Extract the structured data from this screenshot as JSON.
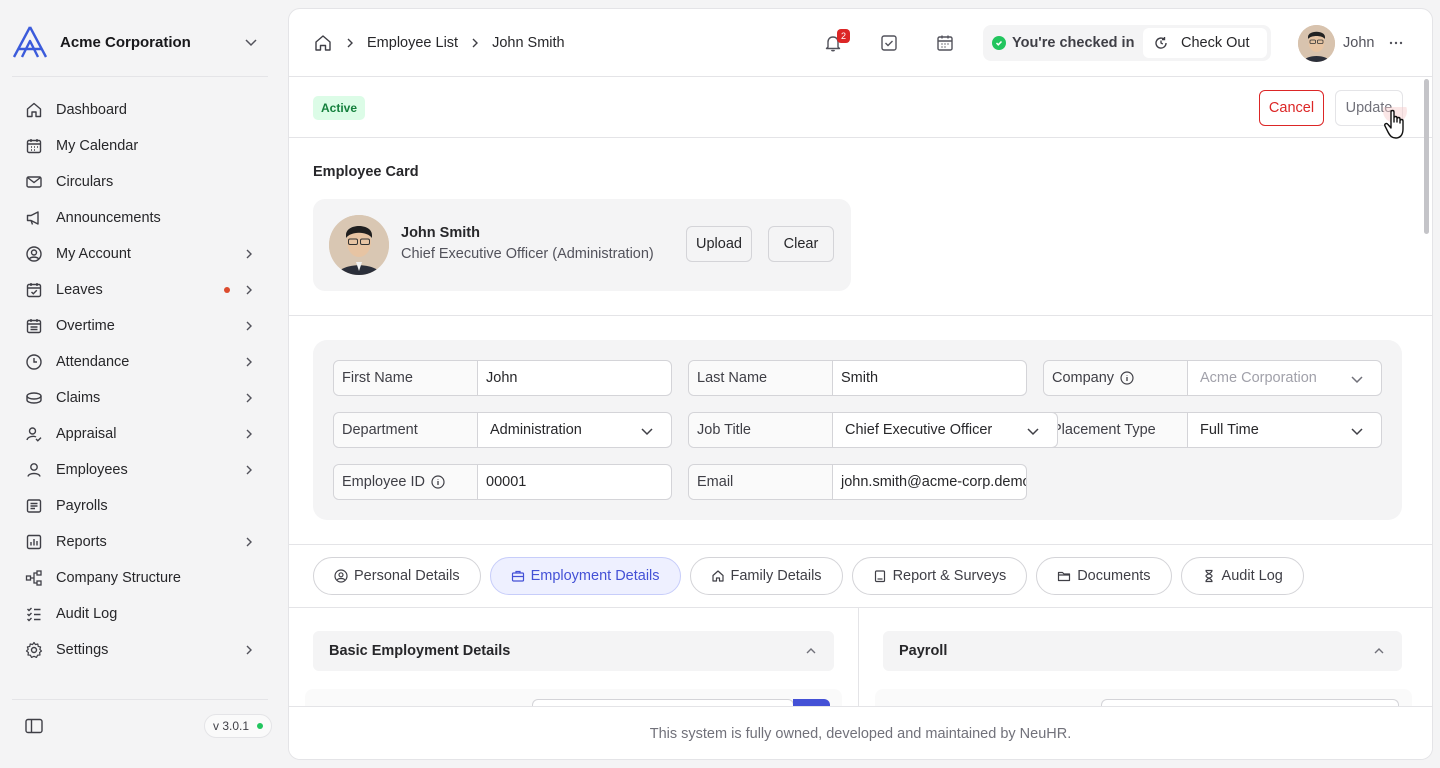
{
  "sidebar": {
    "company": "Acme Corporation",
    "items": [
      {
        "label": "Dashboard",
        "icon": "home-icon",
        "arrow": false
      },
      {
        "label": "My Calendar",
        "icon": "calendar-icon",
        "arrow": false
      },
      {
        "label": "Circulars",
        "icon": "mail-icon",
        "arrow": false
      },
      {
        "label": "Announcements",
        "icon": "megaphone-icon",
        "arrow": false
      },
      {
        "label": "My Account",
        "icon": "user-circle-icon",
        "arrow": true
      },
      {
        "label": "Leaves",
        "icon": "calendar-check-icon",
        "arrow": true,
        "dot": true
      },
      {
        "label": "Overtime",
        "icon": "calendar-grid-icon",
        "arrow": true
      },
      {
        "label": "Attendance",
        "icon": "clock-icon",
        "arrow": true
      },
      {
        "label": "Claims",
        "icon": "coins-icon",
        "arrow": true
      },
      {
        "label": "Appraisal",
        "icon": "user-check-icon",
        "arrow": true
      },
      {
        "label": "Employees",
        "icon": "user-icon",
        "arrow": true
      },
      {
        "label": "Payrolls",
        "icon": "receipt-icon",
        "arrow": false
      },
      {
        "label": "Reports",
        "icon": "bar-chart-icon",
        "arrow": true
      },
      {
        "label": "Company Structure",
        "icon": "org-chart-icon",
        "arrow": false
      },
      {
        "label": "Audit Log",
        "icon": "checklist-icon",
        "arrow": false
      },
      {
        "label": "Settings",
        "icon": "gear-icon",
        "arrow": true
      }
    ],
    "version": "v 3.0.1"
  },
  "topbar": {
    "breadcrumbs": [
      "Employee List",
      "John Smith"
    ],
    "notification_count": "2",
    "checkin_status": "You're checked in",
    "checkout_label": "Check Out",
    "user_name": "John"
  },
  "status": {
    "badge": "Active",
    "cancel_label": "Cancel",
    "update_label": "Update"
  },
  "employee_card": {
    "section_title": "Employee Card",
    "name": "John Smith",
    "title": "Chief Executive Officer (Administration)",
    "upload_label": "Upload",
    "clear_label": "Clear"
  },
  "fields": {
    "first_name": {
      "label": "First Name",
      "value": "John"
    },
    "last_name": {
      "label": "Last Name",
      "value": "Smith"
    },
    "company": {
      "label": "Company",
      "value": "Acme Corporation"
    },
    "department": {
      "label": "Department",
      "value": "Administration"
    },
    "job_title": {
      "label": "Job Title",
      "value": "Chief Executive Officer"
    },
    "placement_type": {
      "label": "Placement Type",
      "value": "Full Time"
    },
    "employee_id": {
      "label": "Employee ID",
      "value": "00001"
    },
    "email": {
      "label": "Email",
      "value": "john.smith@acme-corp.demo"
    }
  },
  "tabs": [
    {
      "label": "Personal Details",
      "icon": "user-circle-icon",
      "active": false
    },
    {
      "label": "Employment Details",
      "icon": "briefcase-icon",
      "active": true
    },
    {
      "label": "Family Details",
      "icon": "home-icon",
      "active": false
    },
    {
      "label": "Report & Surveys",
      "icon": "clipboard-icon",
      "active": false
    },
    {
      "label": "Documents",
      "icon": "folder-icon",
      "active": false
    },
    {
      "label": "Audit Log",
      "icon": "hourglass-icon",
      "active": false
    }
  ],
  "sections": {
    "left": "Basic Employment Details",
    "right": "Payroll"
  },
  "footer": "This system is fully owned, developed and maintained by NeuHR.",
  "colors": {
    "accent": "#4451d6",
    "danger": "#dc2626",
    "success": "#22c55e"
  }
}
